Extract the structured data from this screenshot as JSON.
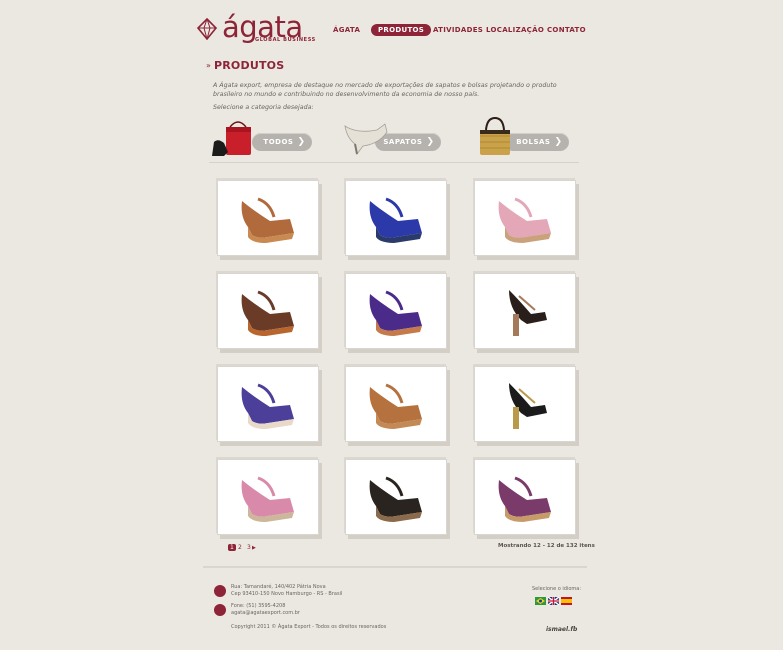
{
  "brand": {
    "name": "ágata",
    "tagline": "GLOBAL BUSINESS"
  },
  "nav": [
    {
      "label": "ÁGATA",
      "active": false
    },
    {
      "label": "PRODUTOS",
      "active": true
    },
    {
      "label": "ATIVIDADES",
      "active": false
    },
    {
      "label": "LOCALIZAÇÃO",
      "active": false
    },
    {
      "label": "CONTATO",
      "active": false
    }
  ],
  "page": {
    "title": "PRODUTOS",
    "intro": "A Ágata export, empresa de destaque no mercado de exportações de sapatos e bolsas projetando o produto brasileiro no mundo e contribuindo no desenvolvimento da economia de nosso país.",
    "select_label": "Selecione a categoria desejada:"
  },
  "categories": [
    {
      "label": "TODOS",
      "icon": "bag-and-shoe-icon"
    },
    {
      "label": "SAPATOS",
      "icon": "shoe-icon"
    },
    {
      "label": "BOLSAS",
      "icon": "handbag-icon"
    }
  ],
  "products": [
    {
      "name": "brown wedge sandal",
      "colors": [
        "#b06a3c",
        "#c98a52"
      ]
    },
    {
      "name": "blue wedge sandal",
      "colors": [
        "#2b3aa8",
        "#2a3a6a"
      ]
    },
    {
      "name": "floral wedge sandal",
      "colors": [
        "#e3a7b8",
        "#c9a17a"
      ]
    },
    {
      "name": "printed wedge sandal",
      "colors": [
        "#6a3b26",
        "#b8662e"
      ]
    },
    {
      "name": "purple studded wedge",
      "colors": [
        "#4a2b8a",
        "#c47a4a"
      ]
    },
    {
      "name": "leopard heeled sandal",
      "colors": [
        "#2a1e1a",
        "#a47a5a"
      ]
    },
    {
      "name": "purple strappy heel",
      "colors": [
        "#4b3f9a",
        "#e9d9c8"
      ]
    },
    {
      "name": "tan block heel",
      "colors": [
        "#b5723f",
        "#c48a55"
      ]
    },
    {
      "name": "black studded heel",
      "colors": [
        "#1b1b1b",
        "#b89a4a"
      ]
    },
    {
      "name": "floral platform wedge",
      "colors": [
        "#d98aaa",
        "#cdb79a"
      ]
    },
    {
      "name": "leopard wedge",
      "colors": [
        "#2a2420",
        "#8a6a4a"
      ]
    },
    {
      "name": "striped wedge",
      "colors": [
        "#7a3a6a",
        "#c79a6a"
      ]
    }
  ],
  "pagination": {
    "pages": [
      "1",
      "2",
      "3"
    ],
    "next": "▶",
    "count_text": "Mostrando 12 - 12 de 132 itens"
  },
  "footer": {
    "address_line1": "Rua: Tamandaré, 140/402 Pátria Nova",
    "address_line2": "Cep 93410-150 Novo Hamburgo - RS - Brasil",
    "phone": "Fone: (51) 3595-4208",
    "email": "agata@agataexport.com.br",
    "copyright": "Copyright 2011 © Ágata Export - Todos os direitos reservados",
    "language_label": "Selecione o idioma:",
    "credit": "ismael.fb"
  },
  "colors": {
    "accent": "#8d2438",
    "background": "#ebe8e1"
  }
}
